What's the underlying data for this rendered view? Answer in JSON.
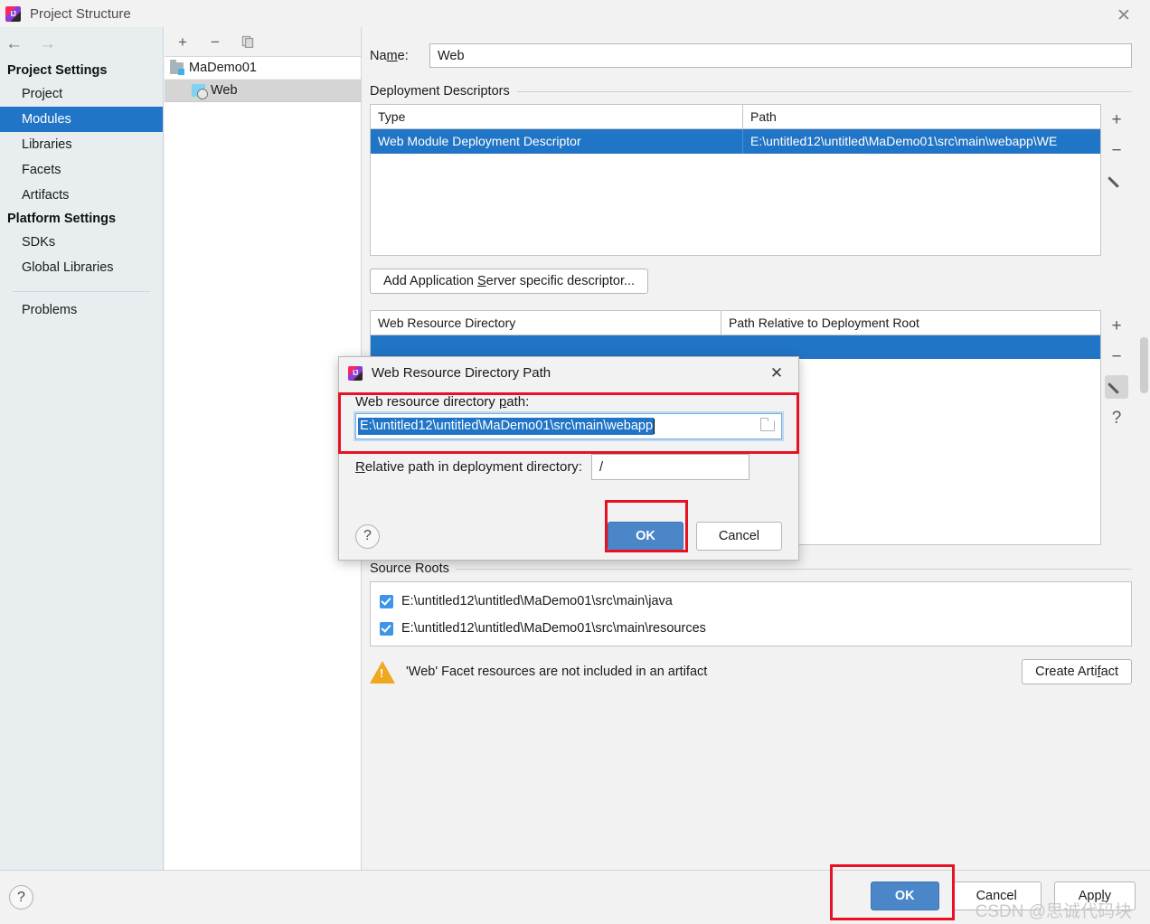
{
  "window": {
    "title": "Project Structure",
    "app_icon": "intellij-idea-icon",
    "close_icon": "✕"
  },
  "sidebar": {
    "back_icon": "←",
    "forward_icon": "→",
    "groups": [
      {
        "label": "Project Settings",
        "items": [
          {
            "label": "Project",
            "selected": false
          },
          {
            "label": "Modules",
            "selected": true
          },
          {
            "label": "Libraries",
            "selected": false
          },
          {
            "label": "Facets",
            "selected": false
          },
          {
            "label": "Artifacts",
            "selected": false
          }
        ]
      },
      {
        "label": "Platform Settings",
        "items": [
          {
            "label": "SDKs",
            "selected": false
          },
          {
            "label": "Global Libraries",
            "selected": false
          }
        ]
      }
    ],
    "problems_label": "Problems"
  },
  "tree_panel": {
    "toolbar": {
      "add_label": "+",
      "remove_label": "−",
      "copy_label": "copy-icon"
    },
    "nodes": [
      {
        "label": "MaDemo01",
        "icon": "module-folder-icon",
        "selected": false
      },
      {
        "label": "Web",
        "icon": "web-facet-icon",
        "selected": true
      }
    ]
  },
  "main": {
    "name_label": "Na̱me:",
    "name_label_pre": "Na",
    "name_label_mnemonic": "m",
    "name_label_post": "e:",
    "name_value": "Web",
    "deployment_descriptors": {
      "section_label": "Deployment Descriptors",
      "columns": [
        "Type",
        "Path"
      ],
      "rows": [
        {
          "type": "Web Module Deployment Descriptor",
          "path": "E:\\untitled12\\untitled\\MaDemo01\\src\\main\\webapp\\WE",
          "selected": true
        }
      ],
      "tools": {
        "add": "+",
        "remove": "−",
        "edit": "pencil-icon"
      }
    },
    "add_descriptor_button": {
      "pre": "Add Application ",
      "mnemonic": "S",
      "post": "erver specific descriptor..."
    },
    "web_resource_directories": {
      "columns": [
        "Web Resource Directory",
        "Path Relative to Deployment Root"
      ],
      "visible_column_fragment": "elative to Deployment Root",
      "rows": [
        {
          "selected": true
        }
      ],
      "tools": {
        "add": "+",
        "remove": "−",
        "edit": "pencil-icon",
        "help": "?"
      }
    },
    "source_roots": {
      "section_label": "Source Roots",
      "items": [
        {
          "path": "E:\\untitled12\\untitled\\MaDemo01\\src\\main\\java",
          "checked": true
        },
        {
          "path": "E:\\untitled12\\untitled\\MaDemo01\\src\\main\\resources",
          "checked": true
        }
      ]
    },
    "warning": {
      "icon": "warning-triangle-icon",
      "text": "'Web' Facet resources are not included in an artifact",
      "action_button": {
        "pre": "Create Arti",
        "mnemonic": "f",
        "post": "act"
      }
    }
  },
  "bottom_bar": {
    "help_icon": "?",
    "ok_label": "OK",
    "cancel_label": "Cancel",
    "apply_pre": "App",
    "apply_mnemonic": "l",
    "apply_post": "y"
  },
  "modal": {
    "title": "Web Resource Directory Path",
    "app_icon": "intellij-idea-icon",
    "close_icon": "✕",
    "path_label": {
      "pre": "Web resource directory ",
      "mnemonic": "p",
      "post": "ath:"
    },
    "path_value": "E:\\untitled12\\untitled\\MaDemo01\\src\\main\\webapp",
    "path_selected": true,
    "browse_icon": "folder-browse-icon",
    "relative_label": {
      "mnemonic": "R",
      "post": "elative path in deployment directory:"
    },
    "relative_value": "/",
    "help_icon": "?",
    "ok_label": "OK",
    "cancel_label": "Cancel"
  },
  "annotations": {
    "highlight_color": "#e81123",
    "boxes": [
      {
        "name": "path-field-highlight"
      },
      {
        "name": "modal-ok-highlight"
      },
      {
        "name": "dialog-ok-highlight"
      }
    ]
  },
  "watermark": {
    "text": "CSDN @思诚代码块"
  },
  "colors": {
    "accent_blue": "#2175c6",
    "button_blue": "#4a86c8",
    "sidebar_bg": "#e8edf0",
    "warning_orange": "#f0a81e",
    "annotation_red": "#e81123"
  }
}
